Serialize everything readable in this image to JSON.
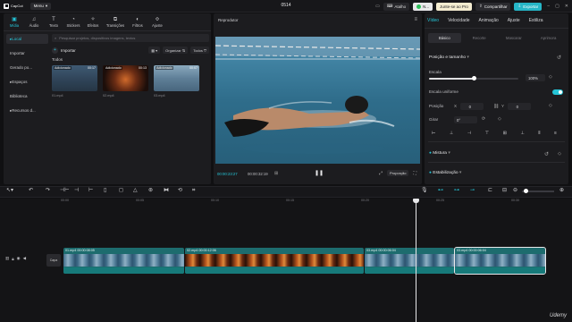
{
  "app": {
    "name": "CapCut",
    "menu_label": "Menu",
    "project_title": "0514"
  },
  "topbar": {
    "shortcuts_label": "Atalho",
    "user_label": "N...",
    "pro_label": "Junte-se ao Pro",
    "share_label": "Compartilhar",
    "export_label": "Exportar"
  },
  "media_tabs": [
    {
      "label": "Mídia",
      "icon": "media-icon",
      "glyph": "▣"
    },
    {
      "label": "Áudio",
      "icon": "audio-icon",
      "glyph": "♫"
    },
    {
      "label": "Texto",
      "icon": "text-icon",
      "glyph": "T"
    },
    {
      "label": "Stickers",
      "icon": "sticker-icon",
      "glyph": "◔"
    },
    {
      "label": "Efeitos",
      "icon": "effects-icon",
      "glyph": "✧"
    },
    {
      "label": "Transições",
      "icon": "transition-icon",
      "glyph": "⧉"
    },
    {
      "label": "Filtros",
      "icon": "filter-icon",
      "glyph": "◐"
    },
    {
      "label": "Ajuste",
      "icon": "adjust-icon",
      "glyph": "≎"
    }
  ],
  "media_sidebar": [
    "Local",
    "Importar",
    "Gerado po...",
    "Espaços",
    "Biblioteca",
    "Recursos d..."
  ],
  "media": {
    "search_placeholder": "Pesquisar projetos, dispositivos imagens, textos",
    "import_label": "Importar",
    "sort_label": "Organizar",
    "filter_label": "Todos",
    "all_label": "Todos",
    "thumbs": [
      {
        "badge": "Adicionado",
        "duration": "00:17",
        "name": "01.mp4"
      },
      {
        "badge": "Adicionado",
        "duration": "00:13",
        "name": "02.mp4"
      },
      {
        "badge": "Adicionado",
        "duration": "00:07",
        "name": "03.mp4"
      }
    ]
  },
  "player": {
    "title": "Reprodutor",
    "current_time": "00:00:23:27",
    "total_time": "00:00:32:19",
    "ratio_label": "Proporção"
  },
  "props": {
    "tabs": [
      "Vídeo",
      "Velocidade",
      "Animação",
      "Ajuste",
      "Estiliza"
    ],
    "subtabs": [
      "Básico",
      "Recorte",
      "Mascarar",
      "Aprimora"
    ],
    "position_size_title": "Posição e tamanho",
    "scale_label": "Escala",
    "scale_value": "100%",
    "scale_level": 0.5,
    "uniform_scale_label": "Escala uniforme",
    "position_label": "Posição",
    "pos_x_label": "X",
    "pos_x_value": "0",
    "pos_y_label": "Y",
    "pos_y_value": "0",
    "rotate_label": "Girar",
    "rotate_value": "0°",
    "blend_title": "Mistura",
    "stabilize_title": "Estabilização"
  },
  "timeline": {
    "ruler_ticks": [
      "00:00",
      "00:05",
      "00:10",
      "00:15",
      "00:20",
      "00:25",
      "00:30"
    ],
    "cover_label": "Capa",
    "clips": [
      {
        "label": "01.mp4   00:00:08:05",
        "kind": "pool"
      },
      {
        "label": "02.mp4   00:00:12:06",
        "kind": "fire"
      },
      {
        "label": "03.mp4   00:00:06:04",
        "kind": "pool"
      },
      {
        "label": "03.mp4   00:00:06:04",
        "kind": "pool"
      }
    ]
  },
  "watermark": "Udemy",
  "colors": {
    "accent": "#25c4d6",
    "clip": "#1d6c6e",
    "export": "#26b6c7"
  }
}
